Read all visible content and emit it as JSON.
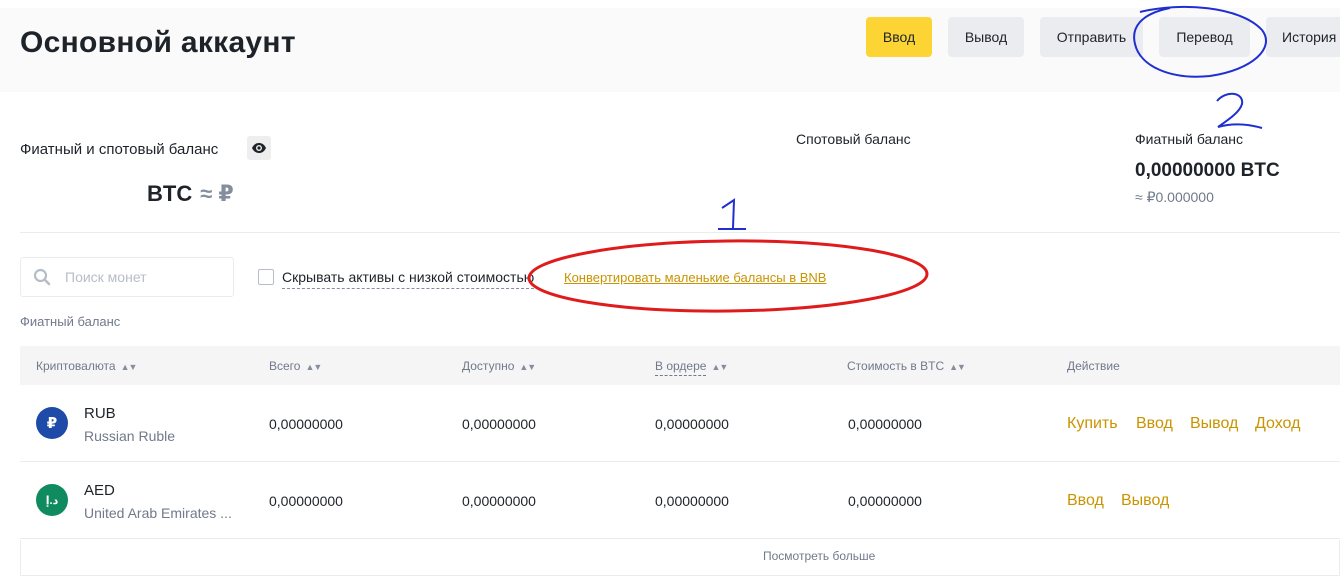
{
  "header": {
    "title": "Основной аккаунт",
    "buttons": {
      "deposit": "Ввод",
      "withdraw": "Вывод",
      "send": "Отправить",
      "transfer": "Перевод",
      "history": "История"
    }
  },
  "balance": {
    "title": "Фиатный и спотовый баланс",
    "btc_approx": "BTC",
    "rub_approx": "≈ ₽",
    "spot_label": "Спотовый баланс",
    "fiat_label": "Фиатный баланс",
    "fiat_value": "0,00000000 BTC",
    "fiat_rub": "≈ ₽0.000000"
  },
  "filters": {
    "search_placeholder": "Поиск монет",
    "hide_small": "Скрывать активы с низкой стоимостью",
    "convert_link": "Конвертировать маленькие балансы в BNB"
  },
  "section_label": "Фиатный баланс",
  "table": {
    "columns": [
      "Криптовалюта",
      "Всего",
      "Доступно",
      "В ордере",
      "Стоимость в BTC",
      "Действие"
    ],
    "rows": [
      {
        "symbol": "RUB",
        "name": "Russian Ruble",
        "icon_glyph": "₽",
        "icon_color": "#1e4ba8",
        "total": "0,00000000",
        "available": "0,00000000",
        "in_order": "0,00000000",
        "btc_value": "0,00000000",
        "actions": [
          "Купить",
          "Ввод",
          "Вывод",
          "Доход"
        ]
      },
      {
        "symbol": "AED",
        "name": "United Arab Emirates ...",
        "icon_glyph": "د.إ",
        "icon_color": "#0f8b5f",
        "total": "0,00000000",
        "available": "0,00000000",
        "in_order": "0,00000000",
        "btc_value": "0,00000000",
        "actions": [
          "Ввод",
          "Вывод"
        ]
      }
    ],
    "show_more": "Посмотреть больше"
  },
  "annotations": {
    "label_1": "1",
    "label_2": "2",
    "color_red": "#e01b1b",
    "color_blue": "#1f2fd0"
  },
  "colors": {
    "accent_yellow": "#fcd535",
    "link_gold": "#c99400"
  }
}
